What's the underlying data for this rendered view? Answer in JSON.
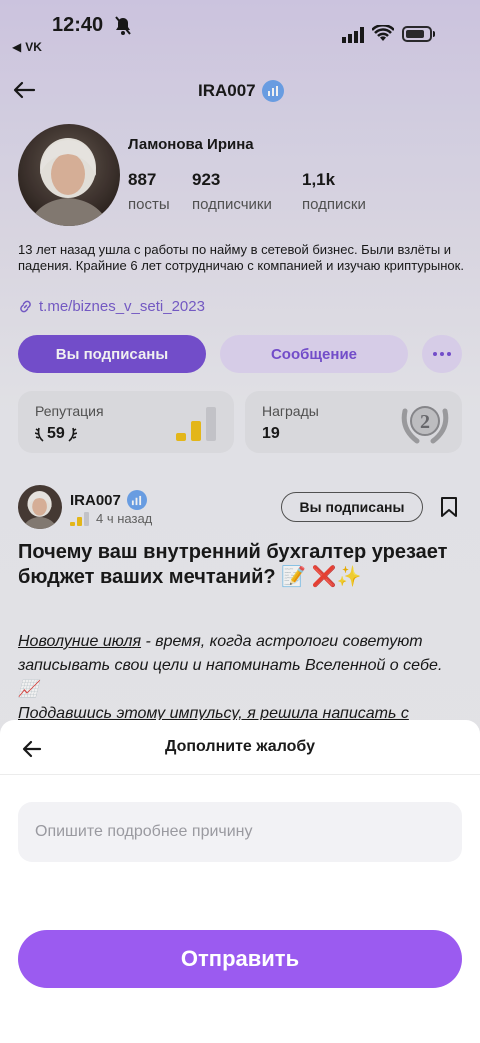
{
  "status_bar": {
    "time": "12:40",
    "back_app": "VK"
  },
  "header": {
    "title": "IRA007"
  },
  "profile": {
    "full_name": "Ламонова Ирина",
    "stats": [
      {
        "value": "887",
        "label": "посты"
      },
      {
        "value": "923",
        "label": "подписчики"
      },
      {
        "value": "1,1k",
        "label": "подписки"
      }
    ],
    "bio": "13 лет назад ушла с работы по найму в сетевой бизнес. Были взлёты и падения. Крайние 6 лет сотрудничаю с компанией и изучаю криптурынок.",
    "link": "t.me/biznes_v_seti_2023",
    "subscribed_label": "Вы подписаны",
    "message_label": "Сообщение",
    "reputation": {
      "title": "Репутация",
      "value": "59"
    },
    "awards": {
      "title": "Награды",
      "value": "19",
      "medal": "2"
    }
  },
  "post": {
    "author": "IRA007",
    "time": "4 ч назад",
    "follow_label": "Вы подписаны",
    "title": "Почему ваш внутренний бухгалтер урезает бюджет ваших мечтаний? 📝 ❌✨",
    "body_link": "Новолуние июля",
    "body_text": " - время, когда астрологи советуют записывать свои цели и напоминать Вселенной о себе. 📈",
    "body_cut": "Поддавшись этому импульсу, я решила написать с"
  },
  "sheet": {
    "title": "Дополните жалобу",
    "input_placeholder": "Опишите подробнее причину",
    "input_value": "",
    "submit_label": "Отправить"
  },
  "colors": {
    "accent": "#7a52d6",
    "submit": "#9b5bf0",
    "light_accent": "#e4d9f6",
    "verified": "#6fa6f0",
    "bar": "#f2c21b"
  }
}
